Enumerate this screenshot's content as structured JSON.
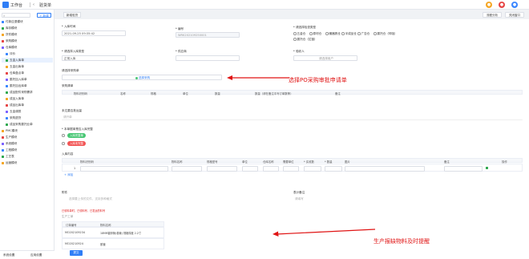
{
  "topbar": {
    "app_name": "工作台",
    "page_name": "验货单"
  },
  "sidebar": {
    "new_button": "+ 新建",
    "items": [
      {
        "label": "付款应退模块"
      },
      {
        "label": "库存模块"
      },
      {
        "label": "货件模块"
      },
      {
        "label": "采购模块"
      },
      {
        "label": "仓库模块"
      },
      {
        "label": "评价"
      },
      {
        "label": "五金入库单"
      },
      {
        "label": "五金出库单"
      },
      {
        "label": "仓库盘点单"
      },
      {
        "label": "委托加入库单"
      },
      {
        "label": "委托加出库单"
      },
      {
        "label": "成品配件采购需求"
      },
      {
        "label": "成品入库单"
      },
      {
        "label": "成品出库单"
      },
      {
        "label": "五金调拨"
      },
      {
        "label": "采购退货"
      },
      {
        "label": "成品采购委托业单"
      },
      {
        "label": "PMC模块"
      },
      {
        "label": "生产模块"
      },
      {
        "label": "系统模块"
      },
      {
        "label": "工程模块"
      },
      {
        "label": "工艺表"
      },
      {
        "label": "运营模块"
      }
    ],
    "footer": {
      "left": "系统设置",
      "right": "应用设置"
    }
  },
  "tabs": {
    "active": "新增验货"
  },
  "toolbar": {
    "help": "流程分析",
    "close": "关闭窗口"
  },
  "form": {
    "entry_time_label": "* 入库时间",
    "entry_time_value": "2021-09-25 09:35:42",
    "number_label": "* 编号",
    "number_value": "WRK202109250001",
    "inspect_type_label": "* 请选择检查类型",
    "inspect_type_options": [
      "五金仓",
      "原材仓",
      "暖器具仓",
      "半成品仓",
      "广告仓",
      "委托仓（呼吸）",
      "委托仓（拉链）"
    ],
    "inbound_type_label": "* 请选择入库类型",
    "inbound_type_value": "正常入库",
    "supplier_label": "* 供应商",
    "inspector_label": "* 验收人",
    "inspector_placeholder": "请选择用户",
    "po_label": "请选择采购单",
    "po_button": "选择采购",
    "purchase_detail_label": "采购清单",
    "purchase_columns": [
      "物料识别码",
      "名称",
      "规格",
      "单位",
      "数量",
      "数量（请在备注中写订单数等）",
      "备注"
    ],
    "not_inspect_label": "未达要否批运量",
    "not_inspect_placeholder": "请开单",
    "need_inspect_label": "* 本单据单是否入库完整",
    "tag_yes": "入库完整单",
    "tag_no": "入库未完整",
    "detail_label": "入库内容",
    "detail_columns": [
      "物料识别码",
      "物料名称",
      "规格型号",
      "单位",
      "仓库名称",
      "需要单位",
      "* 实收数",
      "* 数量",
      "图片",
      "备注",
      "操作"
    ],
    "detail_row_index": "1",
    "add_row": "+ 添加",
    "attachment_label": "附件",
    "attachment_placeholder": "选择要上传的文件，支持多种格式",
    "remark_label": "表计备注",
    "remark_placeholder": "请填写",
    "warning_text": "已领料单时，已领料号，已发运的料号",
    "production_label": "生产工单",
    "prod_columns": [
      "订单编号",
      "物料名称"
    ],
    "prod_rows": [
      {
        "order": "MO202109234",
        "material": "18MM镀锌管(卷管) 规格厚度 2.2寸"
      },
      {
        "order": "MO20210924",
        "material": "胶管"
      }
    ],
    "submit": "提交"
  },
  "annotations": {
    "po_note": "选择PO采购审批申请单",
    "prod_note": "生产报缺物料及时提醒"
  },
  "colors": {
    "accent": "#2f7ef6",
    "annotation": "#e01414",
    "tag_green": "#48c774",
    "tag_red": "#f25555"
  }
}
